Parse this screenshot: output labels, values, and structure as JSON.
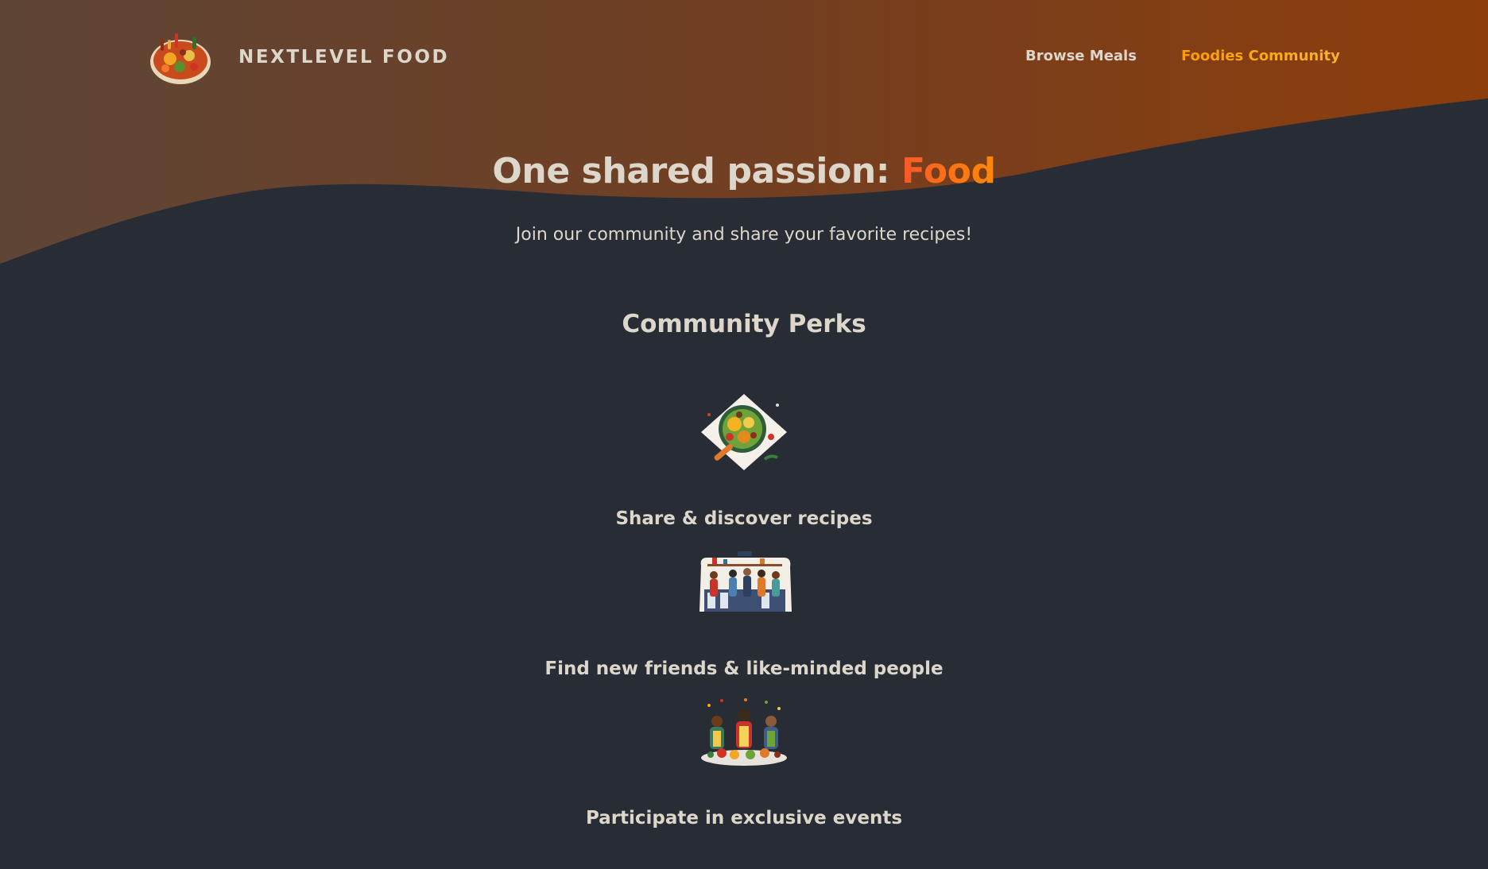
{
  "brand": {
    "name": "NEXTLEVEL FOOD",
    "logo_icon": "food-platter-icon"
  },
  "nav": {
    "items": [
      {
        "label": "Browse Meals",
        "active": false
      },
      {
        "label": "Foodies Community",
        "active": true
      }
    ]
  },
  "hero": {
    "title_prefix": "One shared passion: ",
    "title_highlight": "Food",
    "subtitle": "Join our community and share your favorite recipes!"
  },
  "perks": {
    "title": "Community Perks",
    "items": [
      {
        "label": "Share & discover recipes",
        "icon": "meal-plate-icon"
      },
      {
        "label": "Find new friends & like-minded people",
        "icon": "community-kitchen-icon"
      },
      {
        "label": "Participate in exclusive events",
        "icon": "cooking-event-icon"
      }
    ]
  },
  "colors": {
    "background": "#282c34",
    "header_gradient_start": "#5c4033",
    "header_gradient_end": "#8a3d0e",
    "text": "#ddd6cb",
    "accent_active_nav": "#f9a023",
    "accent_highlight": "#f9572a"
  }
}
